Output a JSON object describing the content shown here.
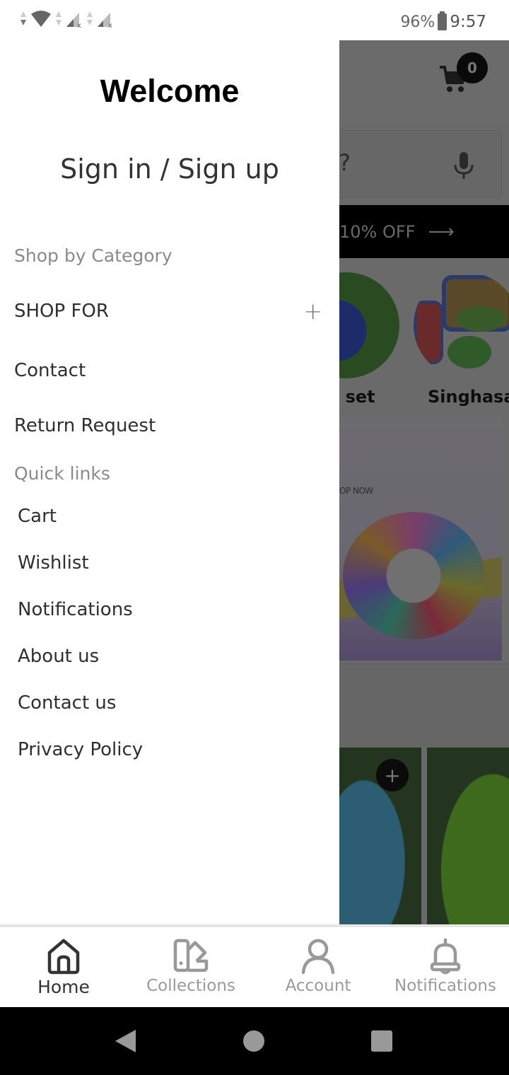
{
  "status_bar": {
    "battery_percent": "96%",
    "time": "9:57",
    "icons": [
      "data-arrows-icon",
      "wifi-icon",
      "signal-sim1-icon",
      "signal-sim2-icon"
    ]
  },
  "drawer": {
    "welcome_title": "Welcome",
    "signin_label": "Sign in / Sign up",
    "shop_by_category_label": "Shop by Category",
    "category_items": [
      {
        "label": "SHOP FOR",
        "expand_icon": "plus-icon"
      },
      {
        "label": "Contact"
      },
      {
        "label": "Return Request"
      }
    ],
    "quick_links_label": "Quick links",
    "quick_links": [
      {
        "label": "Cart"
      },
      {
        "label": "Wishlist"
      },
      {
        "label": "Notifications"
      },
      {
        "label": "About us"
      },
      {
        "label": "Contact us"
      },
      {
        "label": "Privacy Policy"
      }
    ]
  },
  "background_app": {
    "cart_count": "0",
    "search_placeholder_fragment": "?",
    "promo_text": "10% OFF",
    "promo_arrow": "⟶",
    "categories": [
      {
        "label": "l set"
      },
      {
        "label": "Singhasan"
      }
    ],
    "banner_text": "OP NOW",
    "add_button_label": "+"
  },
  "bottom_nav": {
    "tabs": [
      {
        "label": "Home",
        "icon": "home-icon",
        "active": true
      },
      {
        "label": "Collections",
        "icon": "collections-icon",
        "active": false
      },
      {
        "label": "Account",
        "icon": "account-icon",
        "active": false
      },
      {
        "label": "Notifications",
        "icon": "bell-icon",
        "active": false
      }
    ]
  },
  "colors": {
    "drawer_bg": "#ffffff",
    "scrim": "#6a6a6a",
    "text_primary": "#2f2f2f",
    "text_section": "#8a8a8a",
    "nav_inactive": "#9a9a9a",
    "nav_active": "#333333"
  }
}
